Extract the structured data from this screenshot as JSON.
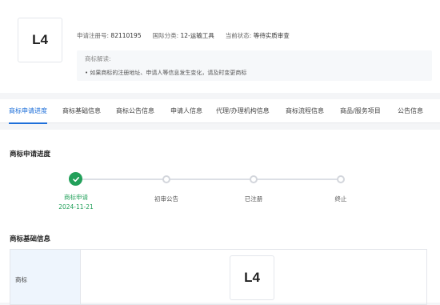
{
  "trademark": {
    "logo_text": "L4",
    "reg_no_label": "申请注册号:",
    "reg_no": "82110195",
    "intl_class_label": "国际分类:",
    "intl_class": "12-运输工具",
    "status_label": "当前状态:",
    "status": "等待实质审查"
  },
  "note": {
    "title": "商标解读:",
    "text": "• 如果商标的注册地址、申请人等信息发生变化，请及时变更商标"
  },
  "tabs": [
    {
      "label": "商标申请进度"
    },
    {
      "label": "商标基础信息"
    },
    {
      "label": "商标公告信息"
    },
    {
      "label": "申请人信息"
    },
    {
      "label": "代理/办理机构信息"
    },
    {
      "label": "商标流程信息"
    },
    {
      "label": "商品/服务项目"
    },
    {
      "label": "公告信息"
    }
  ],
  "progress": {
    "title": "商标申请进度",
    "steps": [
      {
        "label": "商标申请",
        "date": "2024-11-21",
        "done": true
      },
      {
        "label": "初审公告",
        "date": "",
        "done": false
      },
      {
        "label": "已注册",
        "date": "",
        "done": false
      },
      {
        "label": "终止",
        "date": "",
        "done": false
      }
    ]
  },
  "basic_info": {
    "title": "商标基础信息",
    "row_key": "商标",
    "logo_text": "L4"
  },
  "colors": {
    "accent": "#1e6fd9",
    "success": "#22a05a"
  }
}
